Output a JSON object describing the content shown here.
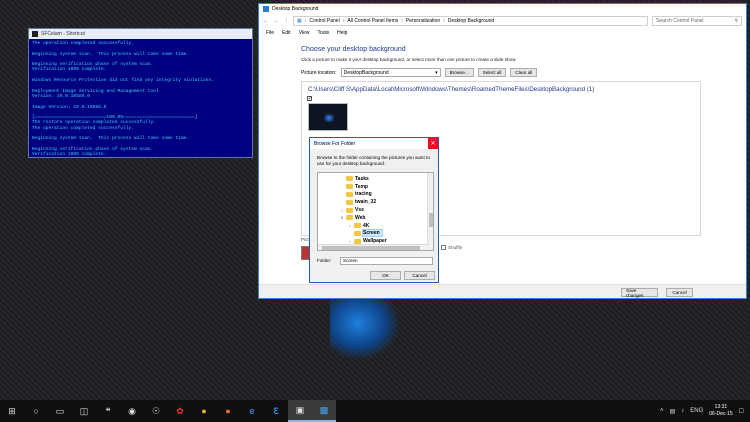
{
  "console": {
    "title": "SFCelam - Shortcut",
    "lines": [
      "The operation completed successfully.",
      "",
      "Beginning system scan.  This process will take some time.",
      "",
      "Beginning verification phase of system scan.",
      "Verification 100% complete.",
      "",
      "Windows Resource Protection did not find any integrity violations.",
      "",
      "Deployment Image Servicing and Management tool",
      "Version: 10.0.10586.0",
      "",
      "Image Version: 10.0.10586.0",
      "",
      "[==========================100.0%==========================]",
      "The restore operation completed successfully.",
      "The operation completed successfully.",
      "",
      "Beginning system scan.  This process will take some time.",
      "",
      "Beginning verification phase of system scan.",
      "Verification 100% complete.",
      "",
      "Windows Resource Protection did not find any integrity violations.",
      "Press any key to continue . . ."
    ]
  },
  "window": {
    "title": "Desktop Background",
    "breadcrumbs": [
      "Control Panel",
      "All Control Panel Items",
      "Personalization",
      "Desktop Background"
    ],
    "search_placeholder": "Search Control Panel",
    "menu": [
      "File",
      "Edit",
      "View",
      "Tools",
      "Help"
    ],
    "heading": "Choose your desktop background",
    "subtext": "Click a picture to make it your desktop background, or select more than one picture to create a slide show.",
    "location_label": "Picture location:",
    "location_value": "DesktopBackground",
    "browse_label": "Browse...",
    "select_all_label": "Select all",
    "clear_all_label": "Clear all",
    "folder_path": "C:\\Users\\Cliff S\\AppData\\Local\\Microsoft\\Windows\\Themes\\RoamedThemeFiles\\DesktopBackground (1)",
    "picture_position_label": "Pictu",
    "shuffle_label": "Shuffle",
    "save_label": "Save changes",
    "cancel_label": "Cancel"
  },
  "dialog": {
    "title": "Browse For Folder",
    "message": "Browse to the folder containing the pictures you want to use for your desktop background.",
    "tree": [
      {
        "label": "Tasks",
        "level": 1,
        "expand": ""
      },
      {
        "label": "Temp",
        "level": 1,
        "expand": ""
      },
      {
        "label": "tracing",
        "level": 1,
        "expand": ""
      },
      {
        "label": "twain_32",
        "level": 1,
        "expand": ""
      },
      {
        "label": "Vss",
        "level": 1,
        "expand": ">"
      },
      {
        "label": "Web",
        "level": 1,
        "expand": "v"
      },
      {
        "label": "4K",
        "level": 2,
        "expand": ">"
      },
      {
        "label": "Screen",
        "level": 2,
        "expand": "",
        "selected": true
      },
      {
        "label": "Wallpaper",
        "level": 2,
        "expand": ">"
      }
    ],
    "folder_label": "Folder:",
    "folder_value": "Screen",
    "ok_label": "OK",
    "cancel_label": "Cancel"
  },
  "taskbar": {
    "time": "13:31",
    "date": "06-Dec-15",
    "language": "ENG"
  }
}
